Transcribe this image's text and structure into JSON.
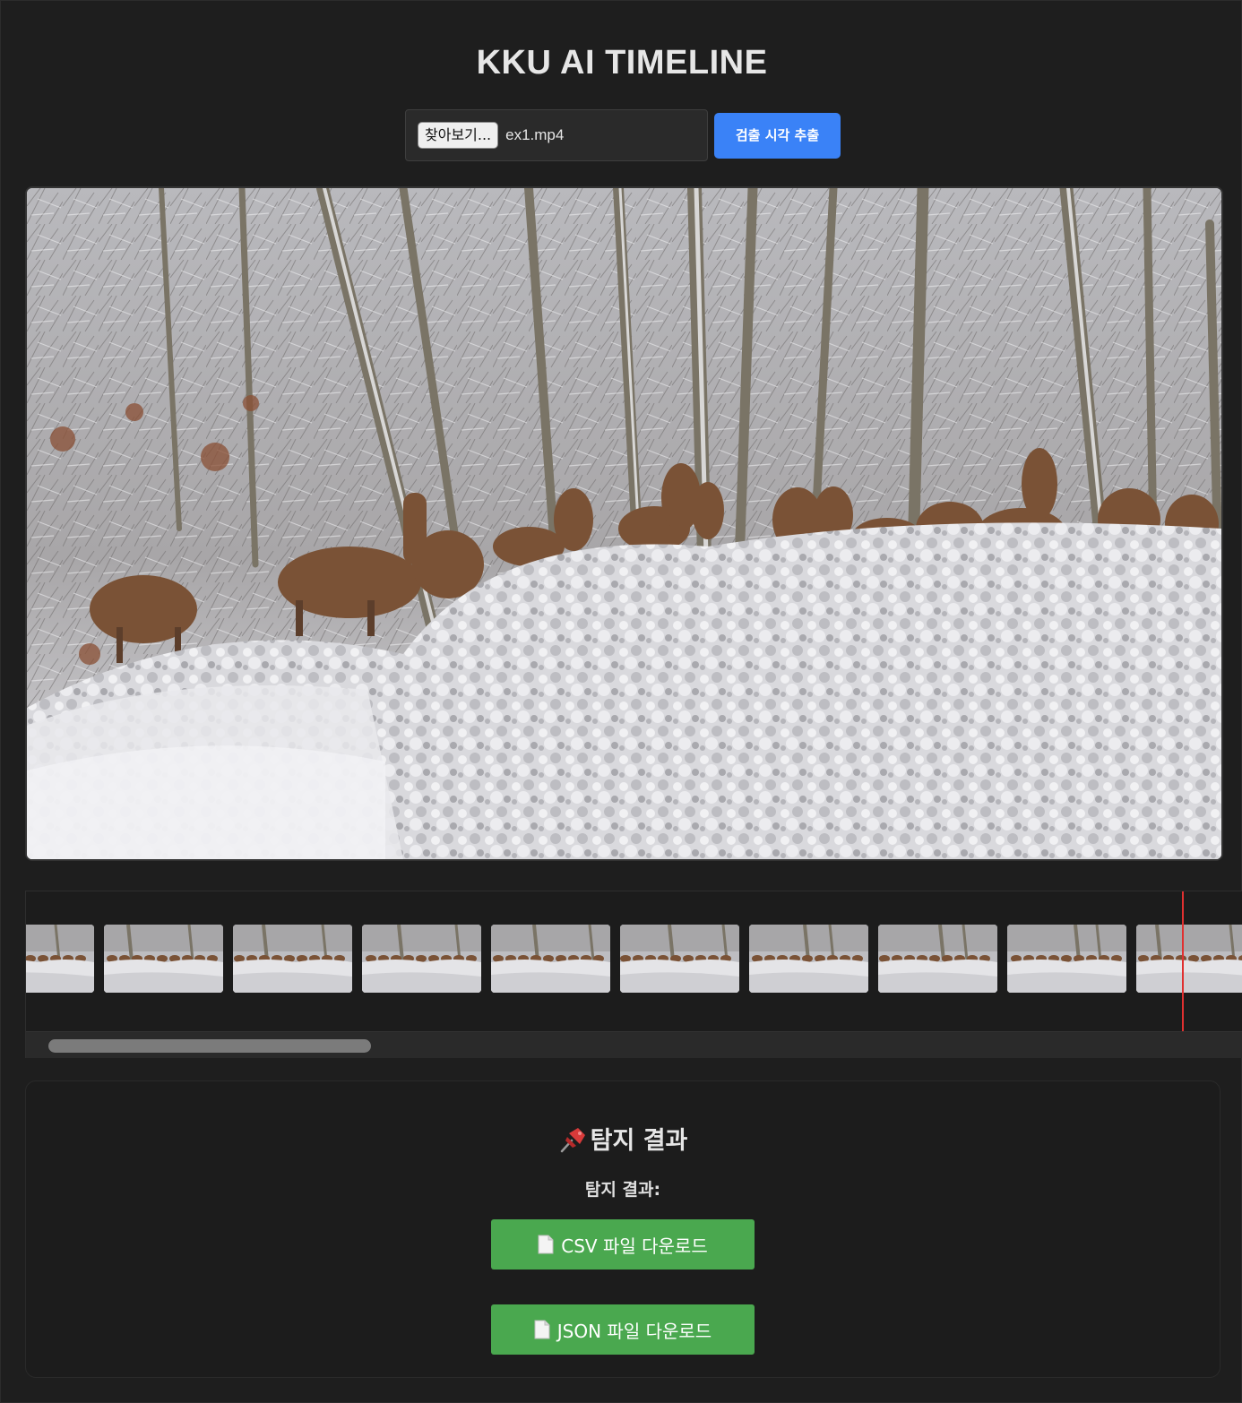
{
  "app": {
    "title": "KKU AI TIMELINE"
  },
  "upload": {
    "browse_label": "찾아보기...",
    "file_name": "ex1.mp4",
    "extract_label": "검출 시각 추출"
  },
  "video": {
    "icon": "video-frame-snowy-forest-deer"
  },
  "timeline": {
    "thumbnail_count": 10,
    "playhead_color": "#e03030"
  },
  "results": {
    "title_icon": "pushpin-icon",
    "title": "탐지 결과",
    "label": "탐지 결과:",
    "csv_icon": "document-icon",
    "csv_label": "CSV 파일 다운로드",
    "json_icon": "document-icon",
    "json_label": "JSON 파일 다운로드"
  },
  "colors": {
    "background": "#1e1e1e",
    "primary_button": "#3a82f7",
    "download_button": "#4aa84f"
  }
}
